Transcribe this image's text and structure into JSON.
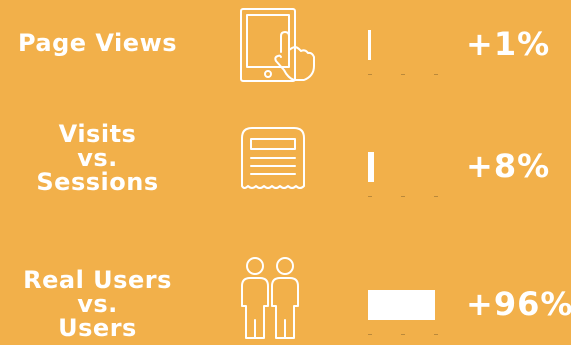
{
  "metrics": [
    {
      "label_lines": [
        "Page Views"
      ],
      "icon": "tablet-touch-icon",
      "percent_text": "+1%",
      "percent_value": 1
    },
    {
      "label_lines": [
        "Visits",
        "vs.",
        "Sessions"
      ],
      "icon": "receipt-icon",
      "percent_text": "+8%",
      "percent_value": 8
    },
    {
      "label_lines": [
        "Real Users",
        "vs.",
        "Users"
      ],
      "icon": "two-users-icon",
      "percent_text": "+96%",
      "percent_value": 96
    }
  ],
  "colors": {
    "background": "#f2b04a",
    "foreground": "#ffffff"
  }
}
